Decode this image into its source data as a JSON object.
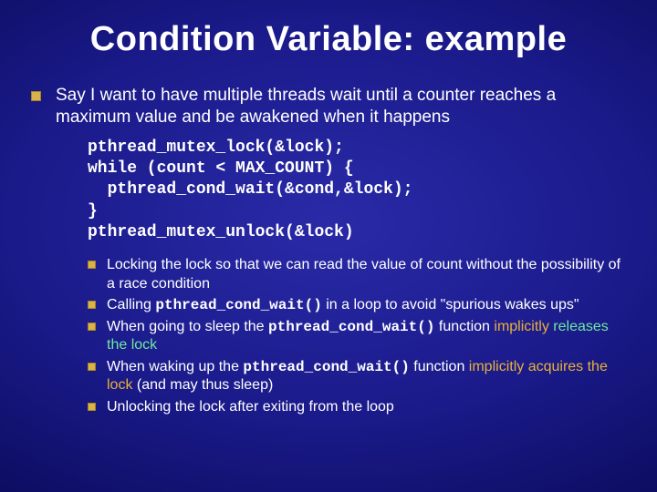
{
  "title": "Condition Variable: example",
  "lead": "Say I want to have multiple threads wait until a counter reaches a maximum value and be awakened when it happens",
  "code": "pthread_mutex_lock(&lock);\nwhile (count < MAX_COUNT) {\n  pthread_cond_wait(&cond,&lock);\n}\npthread_mutex_unlock(&lock)",
  "sub": {
    "b1": "Locking the lock so that we can read the value of count without the possibility of a race condition",
    "b2_a": "Calling ",
    "b2_code": "pthread_cond_wait()",
    "b2_b": " in a loop to avoid \"spurious wakes ups\"",
    "b3_a": "When going to sleep the ",
    "b3_code": "pthread_cond_wait()",
    "b3_b": " function ",
    "b3_acc1": "implicitly",
    "b3_sp": " ",
    "b3_acc2": "releases the lock",
    "b4_a": "When waking up the ",
    "b4_code": "pthread_cond_wait()",
    "b4_b": " function ",
    "b4_acc1": "implicitly acquires the lock",
    "b4_c": " (and may thus sleep)",
    "b5": "Unlocking the lock after exiting from the loop"
  }
}
